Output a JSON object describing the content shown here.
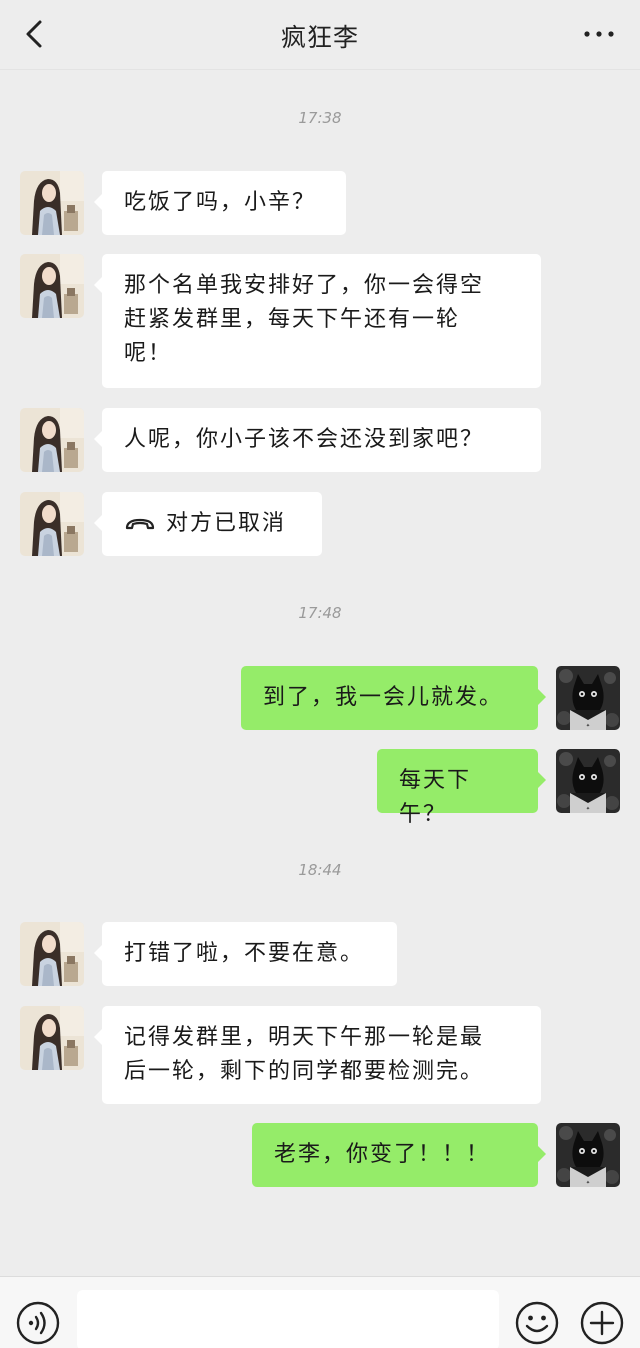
{
  "header": {
    "title": "疯狂李",
    "back_icon": "chevron-left-icon",
    "more_icon": "more-dots-icon"
  },
  "messages": [
    {
      "type": "time",
      "text": "17:38"
    },
    {
      "type": "in",
      "lines": [
        "吃饭了吗，小辛？"
      ]
    },
    {
      "type": "in",
      "lines": [
        "那个名单我安排好了，你一会得空",
        "赶紧发群里，每天下午还有一轮",
        "呢！"
      ]
    },
    {
      "type": "in",
      "lines": [
        "人呢，你小子该不会还没到家吧？"
      ]
    },
    {
      "type": "in-call",
      "icon": "phone-hangup-icon",
      "lines": [
        "对方已取消"
      ]
    },
    {
      "type": "time",
      "text": "17:48"
    },
    {
      "type": "out",
      "lines": [
        "到了，我一会儿就发。"
      ]
    },
    {
      "type": "out",
      "lines": [
        "每天下午？"
      ]
    },
    {
      "type": "time",
      "text": "18:44"
    },
    {
      "type": "in",
      "lines": [
        "打错了啦，不要在意。"
      ]
    },
    {
      "type": "in",
      "lines": [
        "记得发群里，明天下午那一轮是最",
        "后一轮，剩下的同学都要检测完。"
      ]
    },
    {
      "type": "out",
      "lines": [
        "老李，你变了！！！"
      ]
    }
  ],
  "colors": {
    "background": "#ededed",
    "bubble_out": "#95ec69",
    "bubble_in": "#ffffff"
  },
  "footer": {
    "voice_icon": "voice-icon",
    "emoji_icon": "emoji-icon",
    "plus_icon": "plus-icon",
    "input_value": ""
  }
}
